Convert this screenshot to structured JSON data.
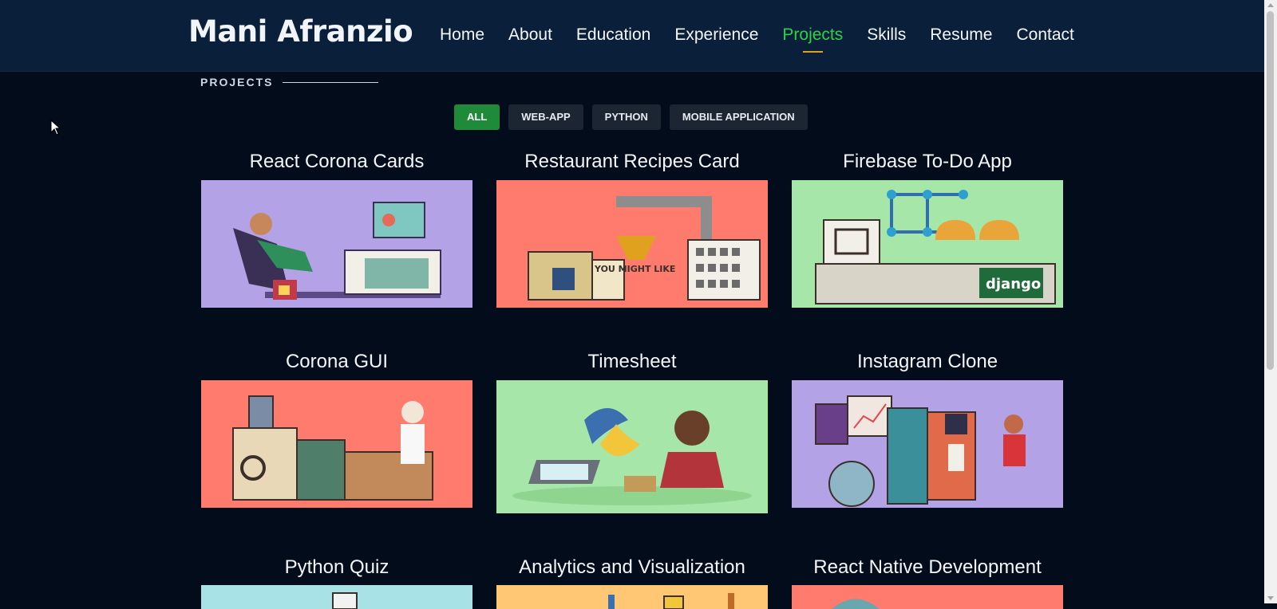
{
  "header": {
    "logo": "Mani Afranzio",
    "nav": [
      "Home",
      "About",
      "Education",
      "Experience",
      "Projects",
      "Skills",
      "Resume",
      "Contact"
    ],
    "active_nav": "Projects"
  },
  "section": {
    "heading": "PROJECTS"
  },
  "filters": {
    "items": [
      "ALL",
      "WEB-APP",
      "PYTHON",
      "MOBILE APPLICATION"
    ],
    "active": "ALL"
  },
  "projects": [
    {
      "title": "React Corona Cards",
      "bg": "#b3a2e6"
    },
    {
      "title": "Restaurant Recipes Card",
      "bg": "#ff7b6e"
    },
    {
      "title": "Firebase To-Do App",
      "bg": "#a6e6a8"
    },
    {
      "title": "Corona GUI",
      "bg": "#ff7b6e"
    },
    {
      "title": "Timesheet",
      "bg": "#a6e6a8"
    },
    {
      "title": "Instagram Clone",
      "bg": "#b3a2e6"
    },
    {
      "title": "Python Quiz",
      "bg": "#a9e2e6"
    },
    {
      "title": "Analytics and Visualization",
      "bg": "#ffc673"
    },
    {
      "title": "React Native Development",
      "bg": "#ff7b6e"
    }
  ],
  "illustration_labels": {
    "you_might_like": "YOU MIGHT LIKE",
    "django": "django"
  },
  "colors": {
    "accent_green": "#2bd24a",
    "underline": "#e0a21e",
    "page_bg": "#020c1b",
    "header_bg": "#0a1f3a"
  }
}
